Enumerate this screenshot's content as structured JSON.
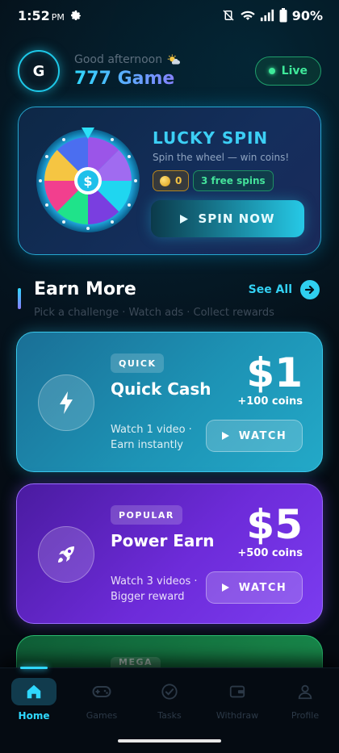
{
  "status": {
    "time": "1:52",
    "ampm": "PM",
    "battery": "90%"
  },
  "header": {
    "avatar_letter": "G",
    "greeting": "Good afternoon",
    "app_title": "777 Game",
    "live_label": "Live"
  },
  "lucky_spin": {
    "title": "LUCKY SPIN",
    "subtitle": "Spin the wheel — win coins!",
    "coins": "0",
    "free_spins": "3 free spins",
    "button": "SPIN NOW",
    "wheel_center": "$"
  },
  "earn_section": {
    "title": "Earn More",
    "subtitle": "Pick a challenge · Watch ads · Collect rewards",
    "see_all": "See All"
  },
  "cards": [
    {
      "tag": "QUICK",
      "name": "Quick Cash",
      "desc": "Watch 1 video · Earn instantly",
      "amount": "$1",
      "coins": "+100 coins",
      "button": "WATCH"
    },
    {
      "tag": "POPULAR",
      "name": "Power Earn",
      "desc": "Watch 3 videos · Bigger reward",
      "amount": "$5",
      "coins": "+500 coins",
      "button": "WATCH"
    },
    {
      "tag": "MEGA"
    }
  ],
  "nav": [
    {
      "label": "Home",
      "icon": "home-icon"
    },
    {
      "label": "Games",
      "icon": "gamepad-icon"
    },
    {
      "label": "Tasks",
      "icon": "check-circle-icon"
    },
    {
      "label": "Withdraw",
      "icon": "wallet-icon"
    },
    {
      "label": "Profile",
      "icon": "user-icon"
    }
  ],
  "colors": {
    "accent": "#2fd8ff",
    "live": "#3ee89a",
    "quick_card": "#1d93b5",
    "power_card": "#6d2bd9",
    "mega_card": "#1c9a52"
  }
}
